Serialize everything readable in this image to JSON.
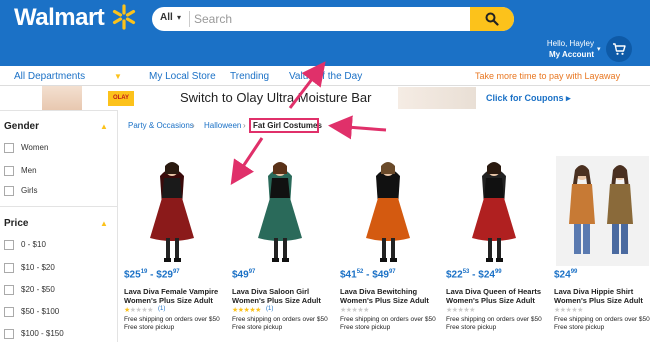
{
  "header": {
    "logo_text": "Walmart",
    "search": {
      "dept": "All",
      "placeholder": "Search"
    },
    "account": {
      "greeting": "Hello, Hayley",
      "menu_label": "My Account"
    }
  },
  "nav": {
    "departments": "All Departments",
    "my_local_store": "My Local Store",
    "trending": "Trending",
    "value_of_day": "Value of the Day",
    "promo": "Take more time to pay with Layaway"
  },
  "banner": {
    "brand": "OLAY",
    "text": "Switch to Olay Ultra Moisture Bar",
    "cta": "Click for Coupons ▸"
  },
  "breadcrumb": {
    "items": [
      "Party & Occasions",
      "Halloween",
      "Fat Girl Costumes"
    ]
  },
  "filters": {
    "gender": {
      "title": "Gender",
      "options": [
        "Women",
        "Men",
        "Girls"
      ]
    },
    "price": {
      "title": "Price",
      "options": [
        "0 - $10",
        "$10 - $20",
        "$20 - $50",
        "$50 - $100",
        "$100 - $150"
      ]
    }
  },
  "products": [
    {
      "price_dollars": "$25",
      "price_cents": "19",
      "price_sep": " - ",
      "price2_dollars": "$29",
      "price2_cents": "97",
      "title1": "Lava Diva Female Vampire",
      "title2": "Women's Plus Size Adult",
      "rating": 1,
      "reviews": "(1)",
      "shipping": "Free shipping on orders over $50",
      "pickup": "Free store pickup"
    },
    {
      "price_dollars": "$49",
      "price_cents": "97",
      "price_sep": "",
      "price2_dollars": "",
      "price2_cents": "",
      "title1": "Lava Diva Saloon Girl",
      "title2": "Women's Plus Size Adult",
      "rating": 5,
      "reviews": "(1)",
      "shipping": "Free shipping on orders over $50",
      "pickup": "Free store pickup"
    },
    {
      "price_dollars": "$41",
      "price_cents": "52",
      "price_sep": " - ",
      "price2_dollars": "$49",
      "price2_cents": "97",
      "title1": "Lava Diva Bewitching",
      "title2": "Women's Plus Size Adult",
      "rating": 0,
      "reviews": "",
      "shipping": "Free shipping on orders over $50",
      "pickup": "Free store pickup"
    },
    {
      "price_dollars": "$22",
      "price_cents": "53",
      "price_sep": " - ",
      "price2_dollars": "$24",
      "price2_cents": "99",
      "title1": "Lava Diva Queen of Hearts",
      "title2": "Women's Plus Size Adult",
      "rating": 0,
      "reviews": "",
      "shipping": "Free shipping on orders over $50",
      "pickup": "Free store pickup"
    },
    {
      "price_dollars": "$24",
      "price_cents": "99",
      "price_sep": "",
      "price2_dollars": "",
      "price2_cents": "",
      "title1": "Lava Diva Hippie Shirt",
      "title2": "Women's Plus Size Adult",
      "rating": 0,
      "reviews": "",
      "shipping": "Free shipping on orders over $50",
      "pickup": "Free store pickup"
    }
  ],
  "colors": {
    "brand_blue": "#1b71c6",
    "spark_yellow": "#fcc21b",
    "highlight_pink": "#e0306a",
    "promo_orange": "#e87722"
  }
}
